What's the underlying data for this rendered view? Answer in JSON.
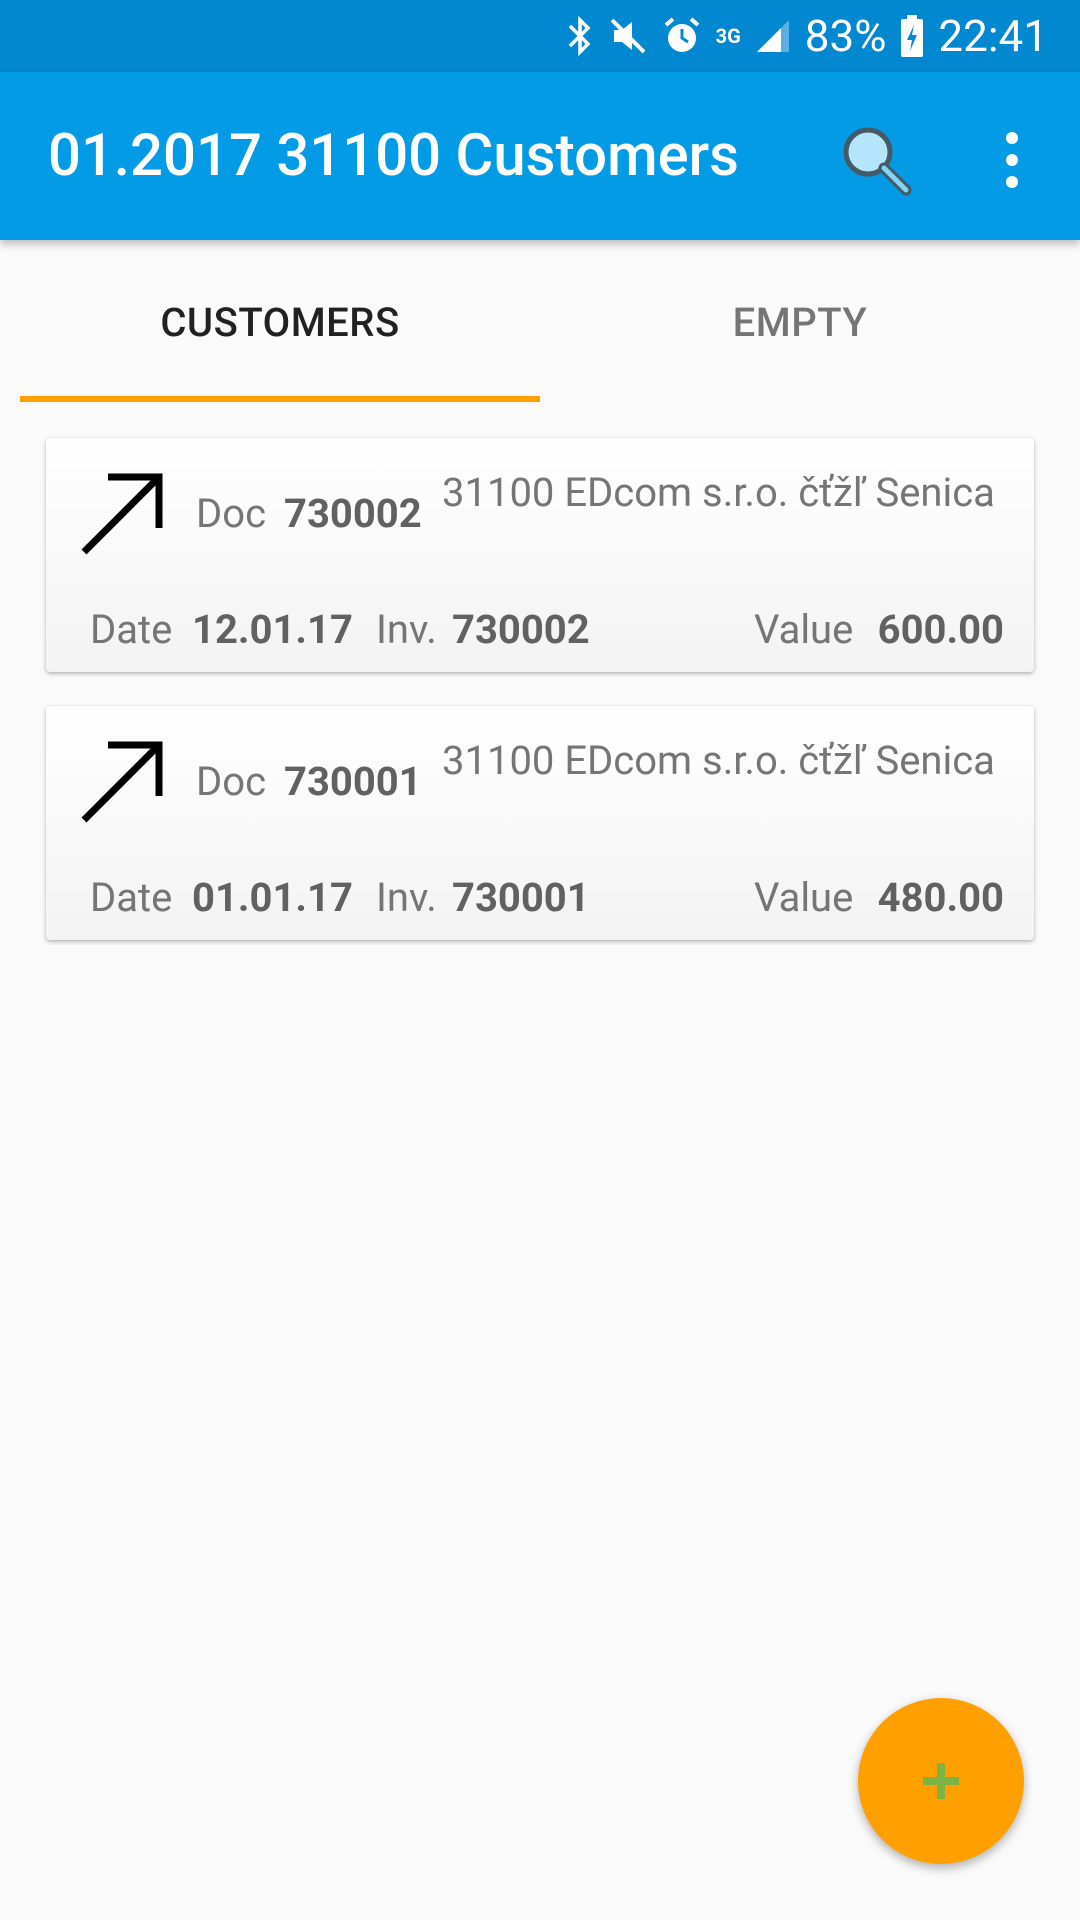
{
  "status_bar": {
    "battery": "83%",
    "time": "22:41",
    "network": "3G",
    "icons": [
      "bluetooth-icon",
      "mute-icon",
      "alarm-icon",
      "3g-icon",
      "signal-icon",
      "battery-charging-icon"
    ]
  },
  "app_bar": {
    "title": "01.2017 31100 Customers",
    "icons": [
      "search-icon",
      "more-vert-icon"
    ],
    "color": "#039be5"
  },
  "tabs": [
    {
      "label": "CUSTOMERS",
      "active": true
    },
    {
      "label": "EMPTY",
      "active": false
    }
  ],
  "accent_color": "#ffa000",
  "cards": [
    {
      "icon": "arrow-up-right-icon",
      "doc_label": "Doc",
      "doc": "730002",
      "customer": "31100 EDcom s.r.o. čťžľ Senica",
      "date_label": "Date",
      "date": "12.01.17",
      "inv_label": "Inv.",
      "inv": "730002",
      "value_label": "Value",
      "value": "600.00"
    },
    {
      "icon": "arrow-up-right-icon",
      "doc_label": "Doc",
      "doc": "730001",
      "customer": "31100 EDcom s.r.o. čťžľ Senica",
      "date_label": "Date",
      "date": "01.01.17",
      "inv_label": "Inv.",
      "inv": "730001",
      "value_label": "Value",
      "value": "480.00"
    }
  ],
  "fab": {
    "icon": "plus-icon"
  }
}
